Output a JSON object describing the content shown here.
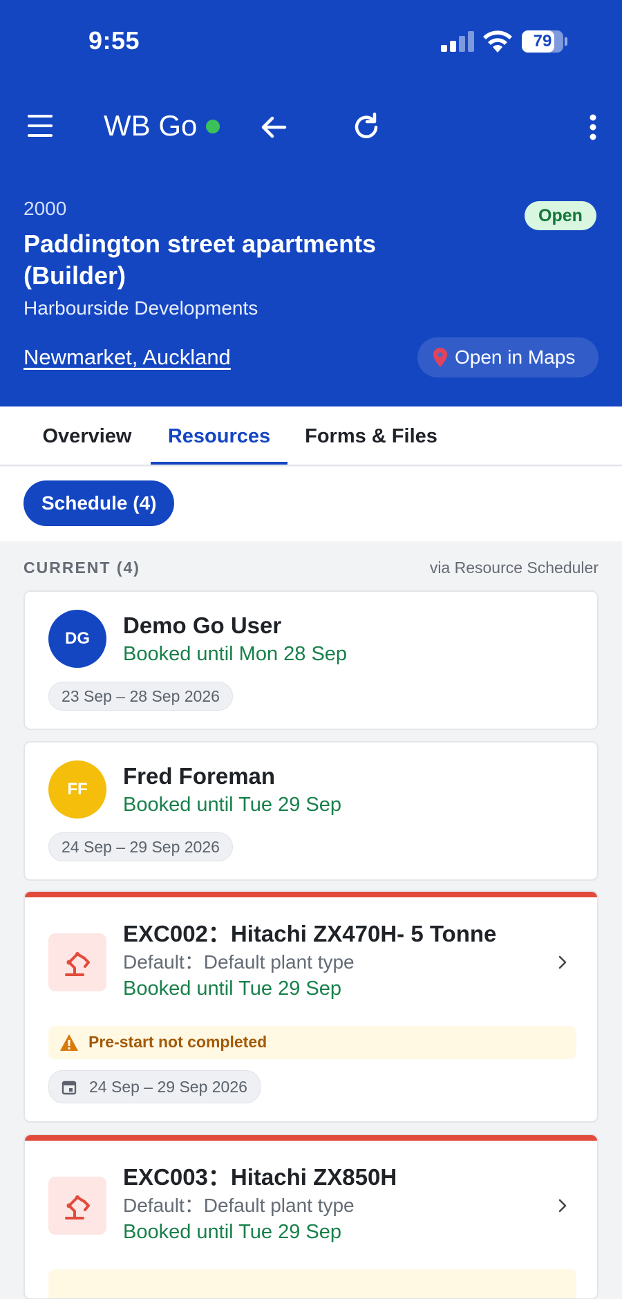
{
  "status_bar": {
    "time": "9:55",
    "battery": "79",
    "battery_level": 0.79
  },
  "toolbar": {
    "app_title": "WB Go"
  },
  "job": {
    "number": "2000",
    "title": "Paddington street apartments (Builder)",
    "client": "Harbourside Developments",
    "location": "Newmarket, Auckland",
    "status": "Open",
    "maps_label": "Open in Maps"
  },
  "tabs": [
    {
      "label": "Overview"
    },
    {
      "label": "Resources"
    },
    {
      "label": "Forms & Files"
    }
  ],
  "schedule_chip": "Schedule (4)",
  "section": {
    "heading": "CURRENT (4)",
    "source": "via Resource Scheduler"
  },
  "resources": [
    {
      "initials": "DG",
      "name": "Demo Go User",
      "booked": "Booked until Mon 28 Sep",
      "dates": "23 Sep – 28 Sep 2026",
      "avatar_color": "#1446c2"
    },
    {
      "initials": "FF",
      "name": "Fred Foreman",
      "booked": "Booked until Tue 29 Sep",
      "dates": "24 Sep – 29 Sep 2026",
      "avatar_color": "#f5be0b"
    },
    {
      "name": "EXC002：Hitachi ZX470H- 5 Tonne",
      "subtype": "Default：Default plant type",
      "booked": "Booked until Tue 29 Sep",
      "warning": "Pre-start not completed",
      "dates": "24 Sep – 29 Sep 2026",
      "icon": "excavator-icon"
    },
    {
      "name": "EXC003：Hitachi ZX850H",
      "subtype": "Default：Default plant type",
      "booked": "Booked until Tue 29 Sep",
      "icon": "excavator-icon"
    }
  ],
  "colors": {
    "primary": "#1446c2",
    "booked_green": "#18804a",
    "alert_red": "#e24b3b",
    "online_green": "#3cc05a"
  }
}
